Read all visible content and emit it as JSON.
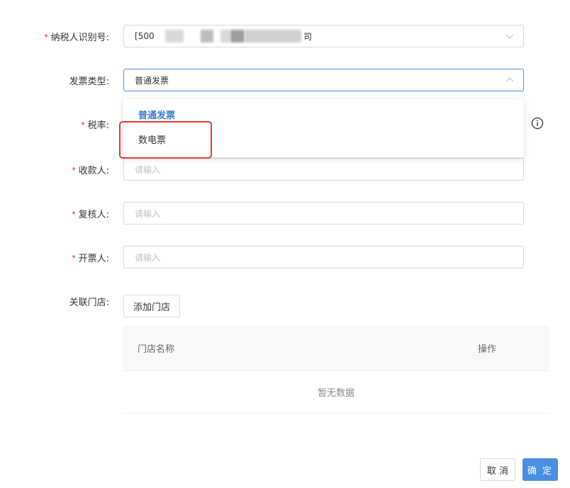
{
  "form": {
    "taxpayer_id": {
      "label": "纳税人识别号:",
      "required": true,
      "value_prefix": "[500",
      "value_suffix": "司"
    },
    "invoice_type": {
      "label": "发票类型:",
      "required": false,
      "value": "普通发票",
      "options": [
        "普通发票",
        "数电票"
      ],
      "selected_option": "普通发票"
    },
    "tax_rate": {
      "label": "税率:",
      "required": true
    },
    "payee": {
      "label": "收款人:",
      "required": true,
      "placeholder": "请输入"
    },
    "reviewer": {
      "label": "复核人:",
      "required": true,
      "placeholder": "请输入"
    },
    "issuer": {
      "label": "开票人:",
      "required": true,
      "placeholder": "请输入"
    },
    "stores": {
      "label": "关联门店:",
      "add_button": "添加门店"
    },
    "required_mark": "*"
  },
  "store_table": {
    "columns": [
      "门店名称",
      "操作"
    ],
    "empty_text": "暂无数据"
  },
  "footer": {
    "cancel_label": "取 消",
    "confirm_label": "确 定"
  },
  "colors": {
    "primary": "#4a90e2",
    "selected_option": "#3a7bd5",
    "required": "#f5222d",
    "highlight_box": "#e53935"
  },
  "icons": {
    "select_closed": "chevron-down-icon",
    "select_open": "chevron-up-icon",
    "info": "info-circle-icon"
  }
}
